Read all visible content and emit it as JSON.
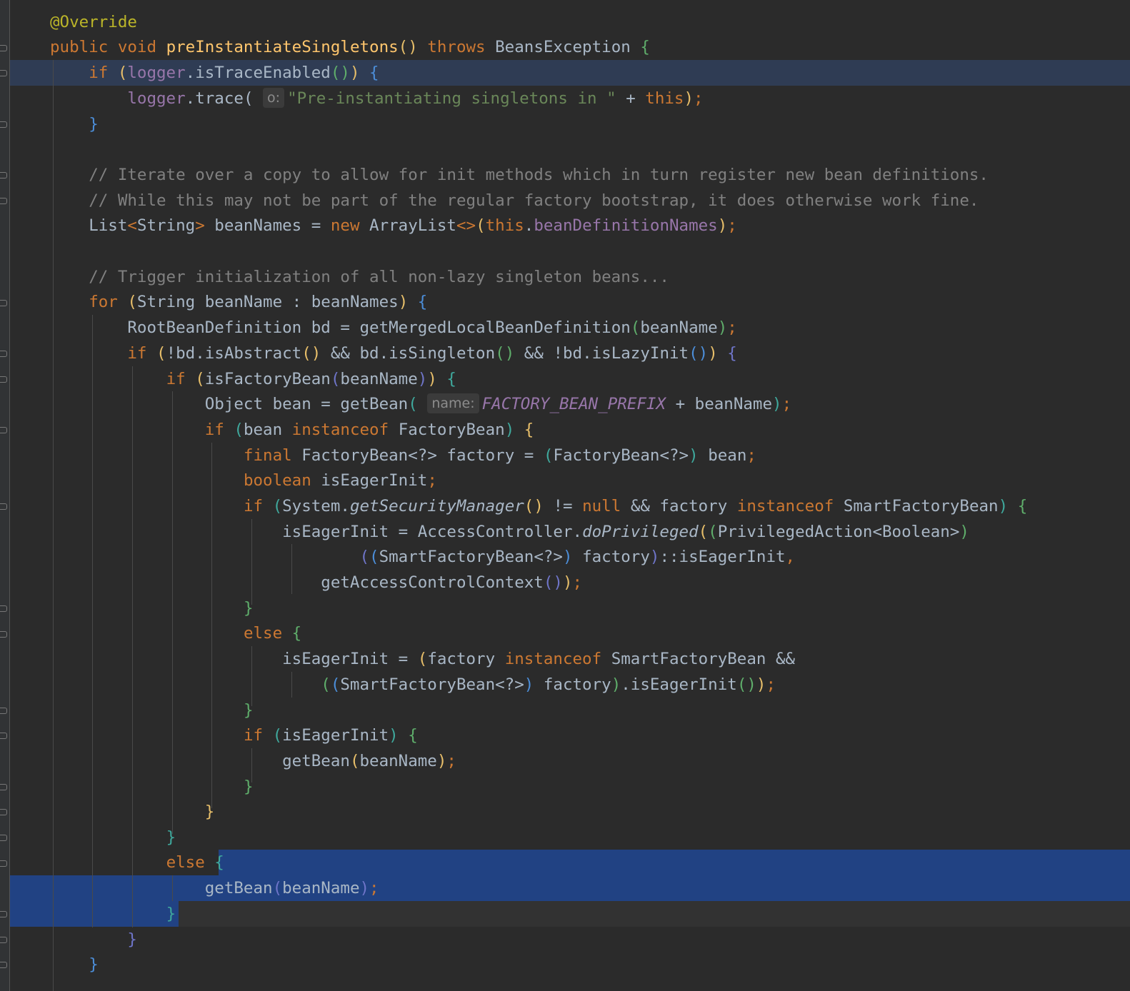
{
  "editor": {
    "language": "Java",
    "theme_colors": {
      "background": "#2b2b2b",
      "keyword": "#cc7832",
      "annotation": "#bbb529",
      "method_declaration": "#ffc66d",
      "string": "#6a8759",
      "comment": "#808080",
      "field": "#9876aa",
      "selection": "#214283",
      "caret_line": "#2f3c54"
    },
    "annotation": "@Override",
    "signature": {
      "modifier": "public",
      "return_type": "void",
      "method": "preInstantiateSingletons",
      "throws": "throws",
      "exception": "BeansException"
    },
    "trace_if": {
      "if": "if",
      "logger": "logger",
      "method": "isTraceEnabled"
    },
    "trace_call": {
      "logger": "logger",
      "method": "trace",
      "hint": "o:",
      "message": "\"Pre-instantiating singletons in \"",
      "plus": "+",
      "this": "this"
    },
    "comments": [
      "// Iterate over a copy to allow for init methods which in turn register new bean definitions.",
      "// While this may not be part of the regular factory bootstrap, it does otherwise work fine.",
      "// Trigger initialization of all non-lazy singleton beans..."
    ],
    "bean_names_line": {
      "type": "List",
      "type_arg": "String",
      "var": "beanNames",
      "new": "new",
      "impl": "ArrayList",
      "this": "this",
      "field": "beanDefinitionNames"
    },
    "for_line": {
      "for": "for",
      "type": "String",
      "var": "beanName",
      "colon": ":",
      "iterable": "beanNames"
    },
    "bd_line": {
      "type": "RootBeanDefinition",
      "var": "bd",
      "method": "getMergedLocalBeanDefinition",
      "arg": "beanName"
    },
    "bd_if": {
      "if": "if",
      "c1": "!bd.isAbstract",
      "c2": "bd.isSingleton",
      "c3": "!bd.isLazyInit"
    },
    "factory_if": {
      "if": "if",
      "method": "isFactoryBean",
      "arg": "beanName"
    },
    "object_line": {
      "type": "Object",
      "var": "bean",
      "method": "getBean",
      "hint": "name:",
      "constant": "FACTORY_BEAN_PREFIX",
      "plus": "+",
      "arg": "beanName"
    },
    "instanceof_if": {
      "if": "if",
      "var": "bean",
      "instanceof": "instanceof",
      "type": "FactoryBean"
    },
    "final_line": {
      "final": "final",
      "type": "FactoryBean<?>",
      "var": "factory",
      "cast": "FactoryBean<?>",
      "value": "bean"
    },
    "boolean_line": {
      "boolean": "boolean",
      "var": "isEagerInit"
    },
    "security_if": {
      "if": "if",
      "system": "System",
      "method": "getSecurityManager",
      "ne": "!=",
      "null": "null",
      "and": "&&",
      "var": "factory",
      "instanceof": "instanceof",
      "type": "SmartFactoryBean"
    },
    "privileged_line": {
      "var": "isEagerInit",
      "cls": "AccessController",
      "method": "doPrivileged",
      "cast": "PrivilegedAction<Boolean>"
    },
    "methodref_line": {
      "cast": "SmartFactoryBean<?>",
      "var": "factory",
      "ref": "::isEagerInit"
    },
    "context_line": {
      "method": "getAccessControlContext"
    },
    "else_label": "else",
    "eager_assign": {
      "var": "isEagerInit",
      "factory": "factory",
      "instanceof": "instanceof",
      "type": "SmartFactoryBean",
      "and": "&&"
    },
    "eager_cast_line": {
      "cast": "SmartFactoryBean<?>",
      "var": "factory",
      "method": "isEagerInit"
    },
    "eager_if": {
      "if": "if",
      "var": "isEagerInit"
    },
    "getbean_call": {
      "method": "getBean",
      "arg": "beanName"
    }
  }
}
